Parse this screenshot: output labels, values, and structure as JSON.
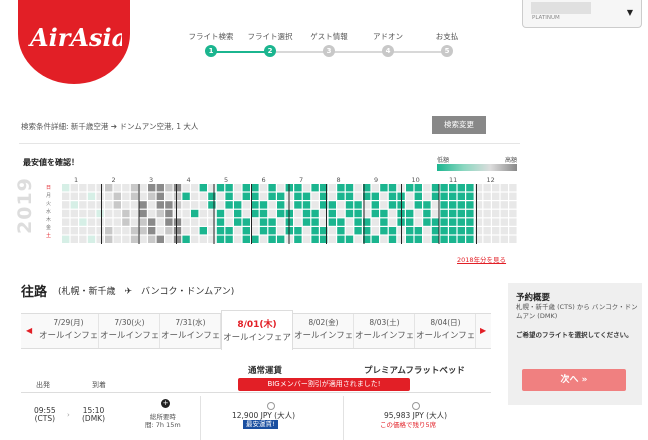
{
  "logo": {
    "text": "AirAsia"
  },
  "steps": [
    {
      "label": "フライト検索",
      "num": "1",
      "active": true
    },
    {
      "label": "フライト選択",
      "num": "2",
      "active": true
    },
    {
      "label": "ゲスト情報",
      "num": "3",
      "active": false
    },
    {
      "label": "アドオン",
      "num": "4",
      "active": false
    },
    {
      "label": "お支払",
      "num": "5",
      "active": false
    }
  ],
  "account": {
    "tier": "PLATINUM",
    "caret": "▼"
  },
  "search": {
    "summary": "検索条件詳細: 新千歳空港 ➔ ドンムアン空港, 1 大人",
    "change_label": "検索変更"
  },
  "calendar": {
    "title": "最安値を確認！",
    "legend_low": "低額",
    "legend_high": "高額",
    "year": "2019",
    "weekdays": [
      "日",
      "月",
      "火",
      "水",
      "木",
      "金",
      "土"
    ],
    "months": [
      "1",
      "2",
      "3",
      "4",
      "5",
      "6",
      "7",
      "8",
      "9",
      "10",
      "11",
      "12"
    ],
    "link": "2018年分を見る",
    "colors": {
      "cheap": "#1bb58f",
      "light": "#d6efe6",
      "grey": "#c8c8c8",
      "dark": "#8a8a8a",
      "empty": "#e8e8e8"
    }
  },
  "outbound": {
    "title": "往路",
    "route": "(札幌・新千歳　✈　バンコク・ドンムアン)"
  },
  "dates": [
    {
      "date": "7/29(月)",
      "fare": "オールインフェア",
      "active": false
    },
    {
      "date": "7/30(火)",
      "fare": "オールインフェア",
      "active": false
    },
    {
      "date": "7/31(水)",
      "fare": "オールインフェア",
      "active": false
    },
    {
      "date": "8/01(木)",
      "fare": "オールインフェア",
      "active": true
    },
    {
      "date": "8/02(金)",
      "fare": "オールインフェア",
      "active": false
    },
    {
      "date": "8/03(土)",
      "fare": "オールインフェア",
      "active": false
    },
    {
      "date": "8/04(日)",
      "fare": "オールインフェア",
      "active": false
    }
  ],
  "fares": {
    "standard": "通常運賃",
    "premium": "プレミアムフラットベッド",
    "banner": "BIGメンバー割引が適用されました!",
    "col_dep": "出発",
    "col_arr": "到着"
  },
  "flight": {
    "dep_time": "09:55",
    "dep_code": "(CTS)",
    "arr_time": "15:10",
    "arr_code": "(DMK)",
    "duration_label": "総所要時",
    "duration": "間: 7h 15m",
    "price_std": "12,900 JPY (大人)",
    "tag_std": "最安運賃!",
    "price_prem": "95,983 JPY (大人)",
    "warn_prem": "この価格で残り5席"
  },
  "summary": {
    "title": "予約概要",
    "route": "札幌・新千歳 (CTS) から バンコク・ドンムアン (DMK)",
    "message": "ご希望のフライトを選択してください。",
    "next": "次へ »"
  }
}
